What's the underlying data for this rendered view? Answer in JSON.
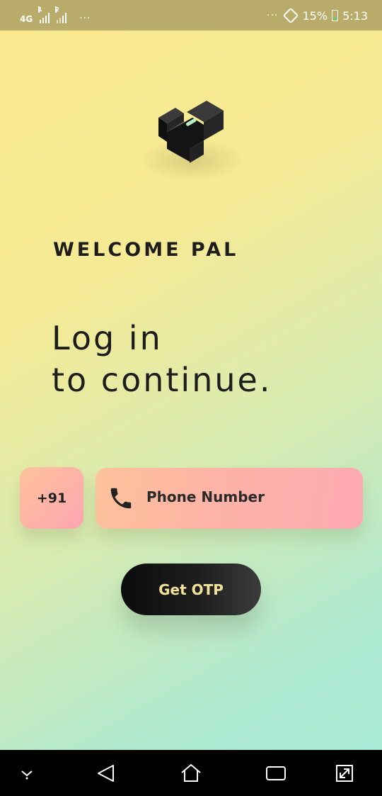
{
  "status_bar": {
    "network_type": "4G",
    "sim1_tag": "1",
    "sim2_tag": "2",
    "left_dots": "···",
    "right_dots": "···",
    "battery_percent": "15%",
    "time": "5:13",
    "icons": [
      "signal-icon",
      "sync-icon",
      "battery-charging-icon"
    ]
  },
  "app": {
    "logo_icon": "app-logo-icon",
    "welcome_text": "WELCOME PAL",
    "headline_line1": "Log in",
    "headline_line2": "to continue."
  },
  "login_form": {
    "country_code": "+91",
    "phone_placeholder": "Phone Number",
    "phone_icon": "phone-icon",
    "submit_label": "Get OTP"
  },
  "nav_bar": {
    "buttons": [
      "hide-nav-icon",
      "back-icon",
      "home-icon",
      "recents-icon",
      "fullscreen-icon"
    ]
  },
  "colors": {
    "background_top": "#fbe98d",
    "background_bottom": "#a6ead8",
    "input_peach": "#fdc29b",
    "input_pink": "#fda9b2",
    "button_dark": "#0b0b0b",
    "button_text": "#f3e398",
    "status_bar": "#b9ac6b"
  }
}
